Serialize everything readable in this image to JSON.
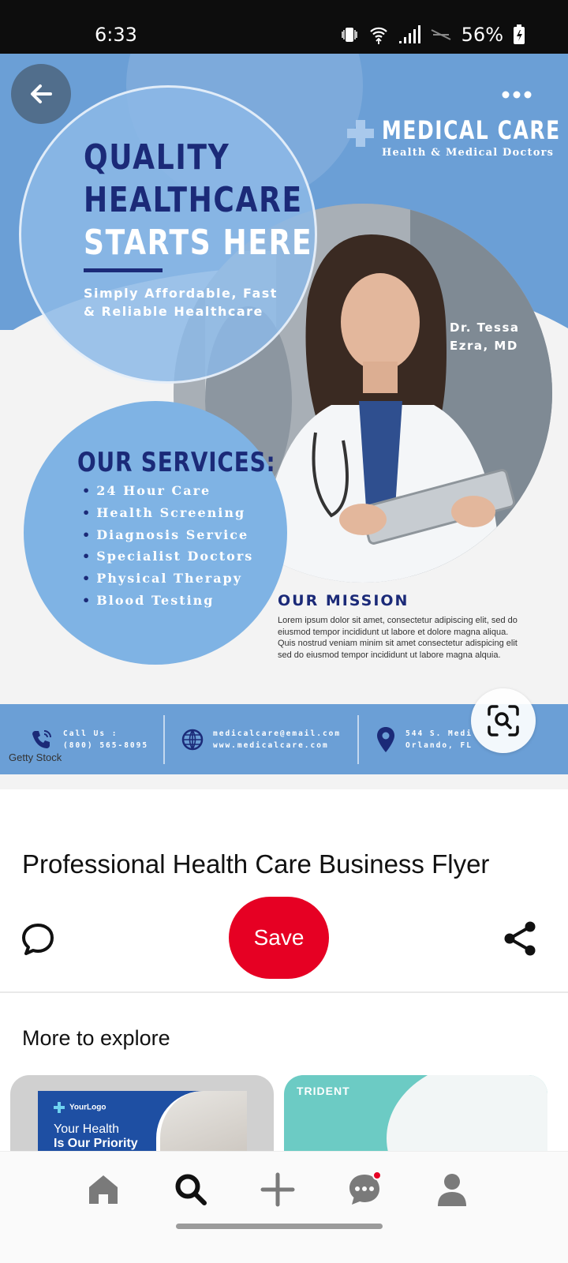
{
  "status_bar": {
    "time": "6:33",
    "battery": "56%"
  },
  "flyer": {
    "headline": [
      "QUALITY",
      "HEALTHCARE",
      "STARTS HERE"
    ],
    "subheadline": "Simply Affordable, Fast & Reliable Healthcare",
    "brand": {
      "name": "MEDICAL CARE",
      "tagline": "Health & Medical Doctors"
    },
    "doctor": "Dr. Tessa Ezra, MD",
    "services_title": "OUR SERVICES:",
    "services": [
      "24 Hour Care",
      "Health Screening",
      "Diagnosis Service",
      "Specialist Doctors",
      "Physical Therapy",
      "Blood Testing"
    ],
    "mission_title": "OUR MISSION",
    "mission_text": "Lorem ipsum dolor sit amet, consectetur adipiscing elit, sed do eiusmod tempor incididunt ut labore et dolore magna aliqua. Quis nostrud veniam minim sit amet consectetur adispicing elit sed do eiusmod tempor incididunt ut labore magna alquia.",
    "contact": {
      "phone_label": "Call Us :",
      "phone": "(800) 565-8095",
      "email": "medicalcare@email.com",
      "website": "www.medicalcare.com",
      "address1": "544 S. Medi",
      "address2": "Orlando, FL"
    },
    "watermark": "Getty Stock"
  },
  "pin": {
    "title": "Professional Health Care Business Flyer",
    "save_label": "Save"
  },
  "explore": {
    "title": "More to explore",
    "cards": [
      {
        "logo": "YourLogo",
        "headline1": "Your Health",
        "headline2": "Is Our Priority"
      },
      {
        "brand": "TRIDENT"
      }
    ]
  },
  "nav": {
    "items": [
      "home-icon",
      "search-icon",
      "plus-icon",
      "messages-icon",
      "profile-icon"
    ]
  },
  "colors": {
    "accent": "#e60023",
    "flyer_blue": "#6b9fd6",
    "flyer_navy": "#1b2a78"
  }
}
